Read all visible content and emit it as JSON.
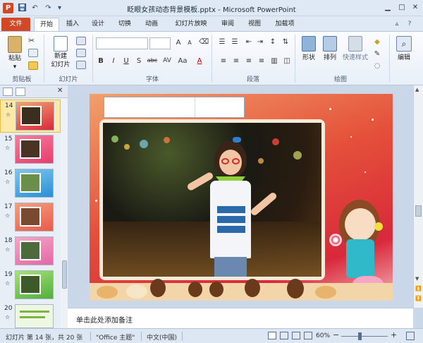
{
  "window": {
    "title": "眨眼女孩动态背景模板.pptx - Microsoft PowerPoint"
  },
  "quick_access": {
    "save_icon": "save-icon",
    "undo_icon": "undo-icon",
    "redo_icon": "redo-icon"
  },
  "tabs": {
    "file": "文件",
    "items": [
      "开始",
      "插入",
      "设计",
      "切换",
      "动画",
      "幻灯片放映",
      "审阅",
      "视图",
      "加载项"
    ],
    "active": "开始"
  },
  "ribbon": {
    "clipboard": {
      "label": "剪贴板",
      "paste": "粘贴"
    },
    "slides": {
      "label": "幻灯片",
      "new_slide": "新建",
      "new_slide2": "幻灯片"
    },
    "font": {
      "label": "字体",
      "bold": "B",
      "italic": "I",
      "underline": "U",
      "strike": "S",
      "shadow": "abc"
    },
    "paragraph": {
      "label": "段落"
    },
    "drawing": {
      "label": "绘图",
      "shapes": "形状",
      "arrange": "排列",
      "quick_styles": "快速样式"
    },
    "editing": {
      "label": "编辑"
    }
  },
  "thumbnails": [
    {
      "num": "14",
      "star": "☆",
      "selected": true
    },
    {
      "num": "15",
      "star": "☆",
      "selected": false
    },
    {
      "num": "16",
      "star": "☆",
      "selected": false
    },
    {
      "num": "17",
      "star": "☆",
      "selected": false
    },
    {
      "num": "18",
      "star": "☆",
      "selected": false
    },
    {
      "num": "19",
      "star": "☆",
      "selected": false
    },
    {
      "num": "20",
      "star": "☆",
      "selected": false
    }
  ],
  "notes": {
    "placeholder": "单击此处添加备注"
  },
  "status": {
    "slide_info": "幻灯片 第 14 张，共 20 张",
    "theme": "\"Office 主题\"",
    "language": "中文(中国)",
    "zoom": "60%"
  },
  "colors": {
    "file_tab": "#d24726",
    "ribbon_bg": "#e8eff8",
    "selected_thumb": "#fde9a7"
  }
}
